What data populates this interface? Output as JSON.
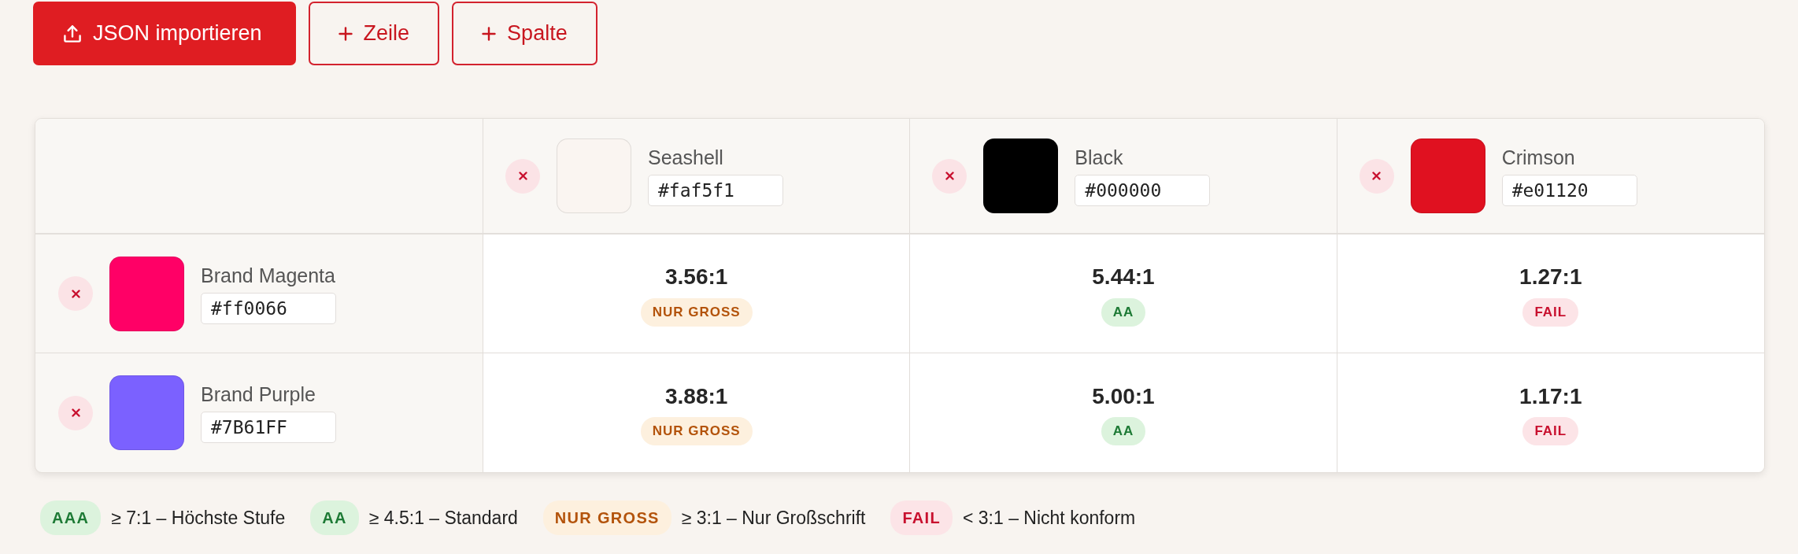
{
  "toolbar": {
    "buttons": [
      {
        "kind": "import",
        "label": "JSON importieren"
      },
      {
        "kind": "add",
        "label": "Zeile"
      },
      {
        "kind": "add",
        "label": "Spalte"
      }
    ]
  },
  "table": {
    "columns": [
      {
        "name": "Seashell",
        "value": "#faf5f1",
        "color": "#faf5f1"
      },
      {
        "name": "Black",
        "value": "#000000",
        "color": "#000000"
      },
      {
        "name": "Crimson",
        "value": "#e01120",
        "color": "#e01120"
      }
    ],
    "rows": [
      {
        "name": "Brand Magenta",
        "value": "#ff0066",
        "color": "#ff0066",
        "cells": [
          {
            "ratio": "3.56:1",
            "rating": "NUR GROSS",
            "kind": "large"
          },
          {
            "ratio": "5.44:1",
            "rating": "AA",
            "kind": "aa"
          },
          {
            "ratio": "1.27:1",
            "rating": "FAIL",
            "kind": "fail"
          }
        ]
      },
      {
        "name": "Brand Purple",
        "value": "#7B61FF",
        "color": "#7b61ff",
        "cells": [
          {
            "ratio": "3.88:1",
            "rating": "NUR GROSS",
            "kind": "large"
          },
          {
            "ratio": "5.00:1",
            "rating": "AA",
            "kind": "aa"
          },
          {
            "ratio": "1.17:1",
            "rating": "FAIL",
            "kind": "fail"
          }
        ]
      }
    ]
  },
  "legend": [
    {
      "kind": "aaa",
      "badge": "AAA",
      "text": "≥ 7:1 – Höchste Stufe"
    },
    {
      "kind": "aa",
      "badge": "AA",
      "text": "≥ 4.5:1 – Standard"
    },
    {
      "kind": "large",
      "badge": "NUR GROSS",
      "text": "≥ 3:1 – Nur Großschrift"
    },
    {
      "kind": "fail",
      "badge": "FAIL",
      "text": "< 3:1 – Nicht konform"
    }
  ]
}
